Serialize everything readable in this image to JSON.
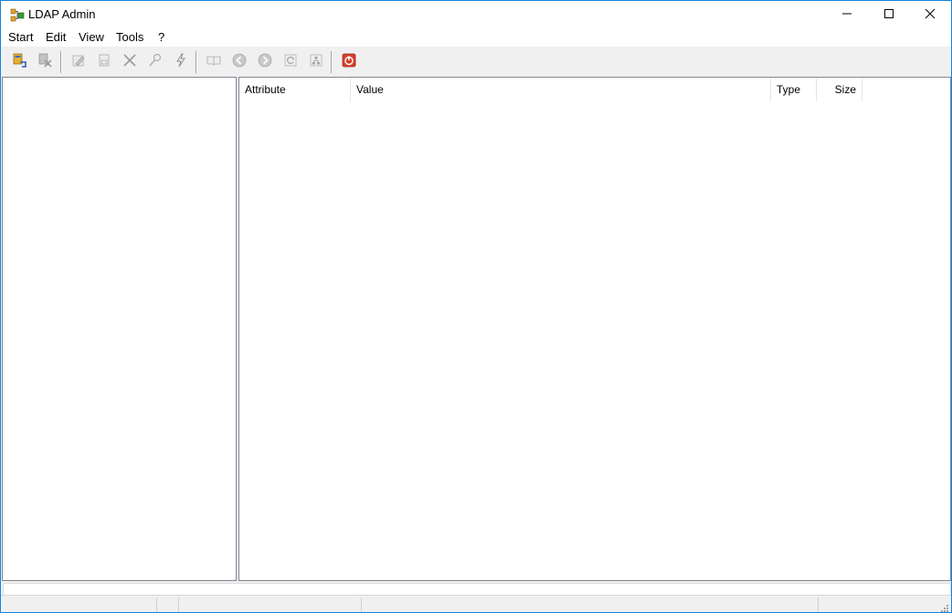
{
  "window": {
    "title": "LDAP Admin",
    "controls": {
      "minimize": "minimize",
      "maximize": "maximize",
      "close": "close"
    }
  },
  "menu": {
    "items": [
      {
        "label": "Start"
      },
      {
        "label": "Edit"
      },
      {
        "label": "View"
      },
      {
        "label": "Tools"
      },
      {
        "label": "?"
      }
    ]
  },
  "toolbar": {
    "buttons": [
      {
        "icon": "connect-icon",
        "enabled": true
      },
      {
        "icon": "disconnect-icon",
        "enabled": false
      },
      {
        "icon": "edit-icon",
        "enabled": false
      },
      {
        "icon": "save-icon",
        "enabled": false
      },
      {
        "icon": "delete-icon",
        "enabled": false
      },
      {
        "icon": "search-icon",
        "enabled": false
      },
      {
        "icon": "lightning-icon",
        "enabled": false
      },
      {
        "icon": "book-icon",
        "enabled": false
      },
      {
        "icon": "back-icon",
        "enabled": false
      },
      {
        "icon": "forward-icon",
        "enabled": false
      },
      {
        "icon": "refresh-icon",
        "enabled": false
      },
      {
        "icon": "schema-icon",
        "enabled": false
      },
      {
        "icon": "exit-icon",
        "enabled": true
      }
    ],
    "accent_exit": "#d6402b"
  },
  "attributes_table": {
    "columns": [
      {
        "label": "Attribute"
      },
      {
        "label": "Value"
      },
      {
        "label": "Type"
      },
      {
        "label": "Size"
      }
    ],
    "rows": []
  },
  "colors": {
    "window_border": "#1883d7",
    "chrome": "#f0f0f0",
    "pane_border": "#828790"
  }
}
